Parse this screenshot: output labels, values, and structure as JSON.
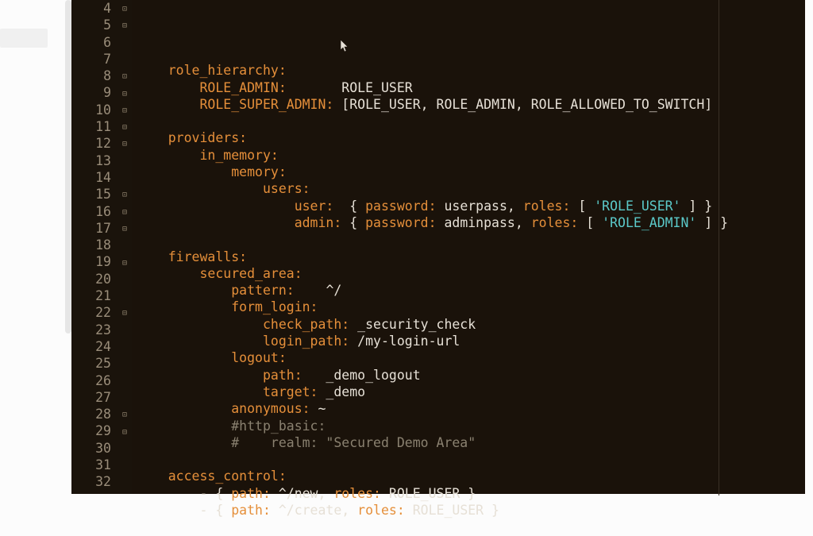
{
  "lines": [
    {
      "n": 4,
      "fold": "mid",
      "segs": []
    },
    {
      "n": 5,
      "fold": "down",
      "segs": [
        [
          "    ",
          ""
        ],
        [
          "role_hierarchy:",
          "key"
        ]
      ]
    },
    {
      "n": 6,
      "fold": "",
      "segs": [
        [
          "        ",
          ""
        ],
        [
          "ROLE_ADMIN:",
          "key"
        ],
        [
          "       ROLE_USER",
          "str"
        ]
      ]
    },
    {
      "n": 7,
      "fold": "",
      "segs": [
        [
          "        ",
          ""
        ],
        [
          "ROLE_SUPER_ADMIN:",
          "key"
        ],
        [
          " [",
          "punc"
        ],
        [
          "ROLE_USER",
          "str"
        ],
        [
          ", ",
          "punc"
        ],
        [
          "ROLE_ADMIN",
          "str"
        ],
        [
          ", ",
          "punc"
        ],
        [
          "ROLE_ALLOWED_TO_SWITCH",
          "str"
        ],
        [
          "]",
          "punc"
        ]
      ]
    },
    {
      "n": 8,
      "fold": "mid",
      "segs": []
    },
    {
      "n": 9,
      "fold": "down",
      "segs": [
        [
          "    ",
          ""
        ],
        [
          "providers:",
          "key"
        ]
      ]
    },
    {
      "n": 10,
      "fold": "down",
      "segs": [
        [
          "        ",
          ""
        ],
        [
          "in_memory:",
          "key"
        ]
      ]
    },
    {
      "n": 11,
      "fold": "down",
      "segs": [
        [
          "            ",
          ""
        ],
        [
          "memory:",
          "key"
        ]
      ]
    },
    {
      "n": 12,
      "fold": "down",
      "segs": [
        [
          "                ",
          ""
        ],
        [
          "users:",
          "key"
        ]
      ]
    },
    {
      "n": 13,
      "fold": "",
      "segs": [
        [
          "                    ",
          ""
        ],
        [
          "user:",
          "key"
        ],
        [
          "  { ",
          "punc"
        ],
        [
          "password:",
          "key"
        ],
        [
          " userpass",
          "str"
        ],
        [
          ", ",
          "punc"
        ],
        [
          "roles:",
          "key"
        ],
        [
          " [ ",
          "punc"
        ],
        [
          "'ROLE_USER'",
          "qstr"
        ],
        [
          " ] }",
          "punc"
        ]
      ]
    },
    {
      "n": 14,
      "fold": "",
      "segs": [
        [
          "                    ",
          ""
        ],
        [
          "admin:",
          "key"
        ],
        [
          " { ",
          "punc"
        ],
        [
          "password:",
          "key"
        ],
        [
          " adminpass",
          "str"
        ],
        [
          ", ",
          "punc"
        ],
        [
          "roles:",
          "key"
        ],
        [
          " [ ",
          "punc"
        ],
        [
          "'ROLE_ADMIN'",
          "qstr"
        ],
        [
          " ] }",
          "punc"
        ]
      ]
    },
    {
      "n": 15,
      "fold": "mid",
      "segs": []
    },
    {
      "n": 16,
      "fold": "down",
      "segs": [
        [
          "    ",
          ""
        ],
        [
          "firewalls:",
          "key"
        ]
      ]
    },
    {
      "n": 17,
      "fold": "down",
      "segs": [
        [
          "        ",
          ""
        ],
        [
          "secured_area:",
          "key"
        ]
      ]
    },
    {
      "n": 18,
      "fold": "",
      "segs": [
        [
          "            ",
          ""
        ],
        [
          "pattern:",
          "key"
        ],
        [
          "    ^/",
          "str"
        ]
      ]
    },
    {
      "n": 19,
      "fold": "down",
      "segs": [
        [
          "            ",
          ""
        ],
        [
          "form_login:",
          "key"
        ]
      ]
    },
    {
      "n": 20,
      "fold": "",
      "segs": [
        [
          "                ",
          ""
        ],
        [
          "check_path:",
          "key"
        ],
        [
          " _security_check",
          "str"
        ]
      ]
    },
    {
      "n": 21,
      "fold": "",
      "segs": [
        [
          "                ",
          ""
        ],
        [
          "login_path:",
          "key"
        ],
        [
          " /my-login-url",
          "str"
        ]
      ]
    },
    {
      "n": 22,
      "fold": "down",
      "segs": [
        [
          "            ",
          ""
        ],
        [
          "logout:",
          "key"
        ]
      ]
    },
    {
      "n": 23,
      "fold": "",
      "segs": [
        [
          "                ",
          ""
        ],
        [
          "path:",
          "key"
        ],
        [
          "   _demo_logout",
          "str"
        ]
      ]
    },
    {
      "n": 24,
      "fold": "",
      "segs": [
        [
          "                ",
          ""
        ],
        [
          "target:",
          "key"
        ],
        [
          " _demo",
          "str"
        ]
      ]
    },
    {
      "n": 25,
      "fold": "",
      "segs": [
        [
          "            ",
          ""
        ],
        [
          "anonymous:",
          "key"
        ],
        [
          " ~",
          "str"
        ]
      ]
    },
    {
      "n": 26,
      "fold": "",
      "segs": [
        [
          "            ",
          ""
        ],
        [
          "#http_basic:",
          "cmt"
        ]
      ]
    },
    {
      "n": 27,
      "fold": "",
      "segs": [
        [
          "            ",
          ""
        ],
        [
          "#    realm: \"Secured Demo Area\"",
          "cmt"
        ]
      ]
    },
    {
      "n": 28,
      "fold": "mid",
      "segs": []
    },
    {
      "n": 29,
      "fold": "down",
      "segs": [
        [
          "    ",
          ""
        ],
        [
          "access_control:",
          "key"
        ]
      ]
    },
    {
      "n": 30,
      "fold": "",
      "segs": [
        [
          "        - { ",
          "punc"
        ],
        [
          "path:",
          "key"
        ],
        [
          " ^/new",
          "str"
        ],
        [
          ", ",
          "punc"
        ],
        [
          "roles:",
          "key"
        ],
        [
          " ROLE_USER",
          "str"
        ],
        [
          " }",
          "punc"
        ]
      ]
    },
    {
      "n": 31,
      "fold": "",
      "segs": [
        [
          "        - { ",
          "punc"
        ],
        [
          "path:",
          "key"
        ],
        [
          " ^/create",
          "str"
        ],
        [
          ", ",
          "punc"
        ],
        [
          "roles:",
          "key"
        ],
        [
          " ROLE_USER",
          "str"
        ],
        [
          " }",
          "punc"
        ]
      ]
    },
    {
      "n": 32,
      "fold": "",
      "segs": []
    }
  ]
}
